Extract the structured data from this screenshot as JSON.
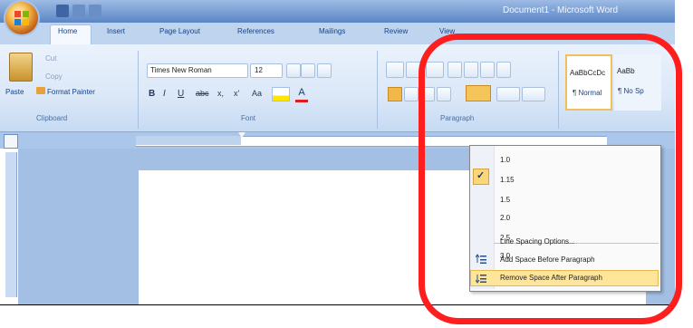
{
  "window": {
    "title": "Document1 - Microsoft Word"
  },
  "tabs": [
    {
      "label": "Home"
    },
    {
      "label": "Insert"
    },
    {
      "label": "Page Layout"
    },
    {
      "label": "References"
    },
    {
      "label": "Mailings"
    },
    {
      "label": "Review"
    },
    {
      "label": "View"
    }
  ],
  "clipboard": {
    "paste": "Paste",
    "cut": "Cut",
    "copy": "Copy",
    "format_painter": "Format Painter",
    "group": "Clipboard"
  },
  "font": {
    "family": "Times New Roman",
    "size": "12",
    "group": "Font"
  },
  "paragraph": {
    "group": "Paragraph"
  },
  "styles": {
    "preview": "AaBbCcDc",
    "preview2": "AaBb",
    "normal": "¶ Normal",
    "nospacing": "¶ No Sp"
  },
  "menu": {
    "items": [
      "1.0",
      "1.15",
      "1.5",
      "2.0",
      "2.5",
      "3.0"
    ],
    "selected": "2.0",
    "options": "Line Spacing Options...",
    "add_before": "Add Space Before Paragraph",
    "remove_after": "Remove Space After Paragraph"
  },
  "colors": {
    "accent": "#ff1e1e",
    "highlight": "#ffe59a",
    "ribbon": "#dbe8f8"
  }
}
